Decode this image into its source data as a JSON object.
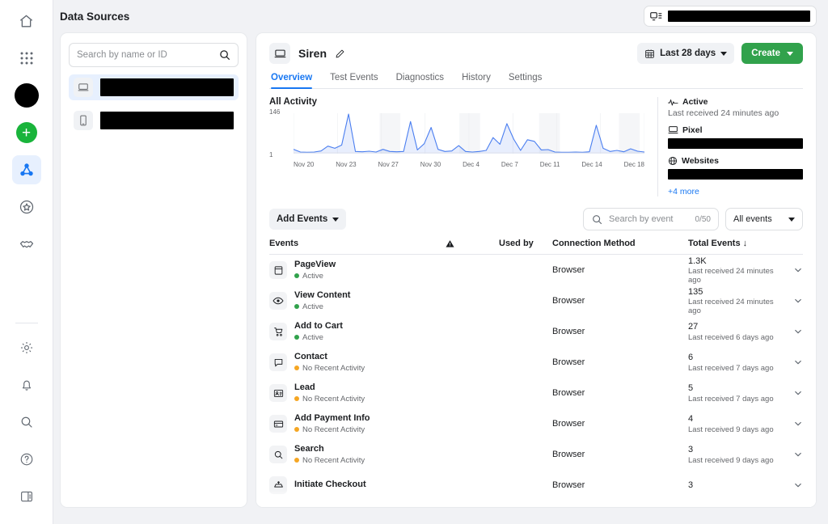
{
  "header": {
    "page_title": "Data Sources",
    "account_pill_icon": "business-account-icon",
    "account_pill_value": "REDACTED"
  },
  "rail": {
    "items": [
      {
        "name": "home-icon",
        "label": "Home"
      },
      {
        "name": "apps-grid-icon",
        "label": "All tools"
      },
      {
        "name": "avatar",
        "label": "Account"
      },
      {
        "name": "plus-circle-icon",
        "label": "Create"
      },
      {
        "name": "data-sources-icon",
        "label": "Data sources",
        "active": true
      },
      {
        "name": "star-badge-icon",
        "label": "Rewards"
      },
      {
        "name": "handshake-icon",
        "label": "Partners"
      }
    ],
    "bottom_items": [
      {
        "name": "gear-icon",
        "label": "Settings"
      },
      {
        "name": "bell-icon",
        "label": "Notifications"
      },
      {
        "name": "search-icon",
        "label": "Search"
      },
      {
        "name": "help-icon",
        "label": "Help"
      },
      {
        "name": "panel-toggle-icon",
        "label": "Toggle panel"
      }
    ]
  },
  "source_list": {
    "search_placeholder": "Search by name or ID",
    "search_value": "",
    "items": [
      {
        "icon": "pixel-icon",
        "label": "REDACTED",
        "selected": true
      },
      {
        "icon": "mobile-app-icon",
        "label": "REDACTED",
        "selected": false
      }
    ]
  },
  "source": {
    "icon": "pixel-icon",
    "name": "Siren",
    "edit_icon": "pencil-icon",
    "date_range": "Last 28 days",
    "create_button": "Create",
    "tabs": [
      {
        "label": "Overview",
        "active": true
      },
      {
        "label": "Test Events",
        "active": false
      },
      {
        "label": "Diagnostics",
        "active": false
      },
      {
        "label": "History",
        "active": false
      },
      {
        "label": "Settings",
        "active": false
      }
    ]
  },
  "activity": {
    "title": "All Activity"
  },
  "info_panel": {
    "status_label": "Active",
    "status_sub": "Last received 24 minutes ago",
    "pixel_label": "Pixel",
    "pixel_value": "REDACTED",
    "websites_label": "Websites",
    "websites_value": "REDACTED",
    "more_link": "+4 more"
  },
  "events_toolbar": {
    "add_events": "Add Events",
    "search_placeholder": "Search by event",
    "search_value": "",
    "search_counter": "0/50",
    "filter_value": "All events"
  },
  "events_table": {
    "columns": {
      "events": "Events",
      "warning_icon": "warning-triangle-icon",
      "used_by": "Used by",
      "connection_method": "Connection Method",
      "total_events": "Total Events",
      "sort_arrow": "↓"
    },
    "rows": [
      {
        "icon": "page-view-icon",
        "name": "PageView",
        "status": "Active",
        "status_color": "#31a24c",
        "used_by": "",
        "connection": "Browser",
        "total": "1.3K",
        "last": "Last received 24 minutes ago"
      },
      {
        "icon": "eye-icon",
        "name": "View Content",
        "status": "Active",
        "status_color": "#31a24c",
        "used_by": "",
        "connection": "Browser",
        "total": "135",
        "last": "Last received 24 minutes ago"
      },
      {
        "icon": "cart-icon",
        "name": "Add to Cart",
        "status": "Active",
        "status_color": "#31a24c",
        "used_by": "",
        "connection": "Browser",
        "total": "27",
        "last": "Last received 6 days ago"
      },
      {
        "icon": "chat-bubble-icon",
        "name": "Contact",
        "status": "No Recent Activity",
        "status_color": "#f5a623",
        "used_by": "",
        "connection": "Browser",
        "total": "6",
        "last": "Last received 7 days ago"
      },
      {
        "icon": "contact-card-icon",
        "name": "Lead",
        "status": "No Recent Activity",
        "status_color": "#f5a623",
        "used_by": "",
        "connection": "Browser",
        "total": "5",
        "last": "Last received 7 days ago"
      },
      {
        "icon": "credit-card-icon",
        "name": "Add Payment Info",
        "status": "No Recent Activity",
        "status_color": "#f5a623",
        "used_by": "",
        "connection": "Browser",
        "total": "4",
        "last": "Last received 9 days ago"
      },
      {
        "icon": "search-icon",
        "name": "Search",
        "status": "No Recent Activity",
        "status_color": "#f5a623",
        "used_by": "",
        "connection": "Browser",
        "total": "3",
        "last": "Last received 9 days ago"
      },
      {
        "icon": "initiate-checkout-icon",
        "name": "Initiate Checkout",
        "status": "",
        "status_color": "#f5a623",
        "used_by": "",
        "connection": "Browser",
        "total": "3",
        "last": ""
      }
    ]
  },
  "chart_data": {
    "type": "area",
    "title": "All Activity",
    "xlabel": "",
    "ylabel": "",
    "ylim": [
      1,
      146
    ],
    "ytick_labels": [
      "146",
      "1"
    ],
    "grid": true,
    "legend": "none",
    "x_tick_labels": [
      "Nov 20",
      "Nov 23",
      "Nov 27",
      "Nov 30",
      "Dec 4",
      "Dec 7",
      "Dec 11",
      "Dec 14",
      "Dec 18"
    ],
    "x": [
      "Nov 20",
      "Nov 21",
      "Nov 22",
      "Nov 23",
      "Nov 24",
      "Nov 25",
      "Nov 26",
      "Nov 27",
      "Nov 28",
      "Nov 29",
      "Nov 30",
      "Dec 1",
      "Dec 2",
      "Dec 3",
      "Dec 4",
      "Dec 5",
      "Dec 6",
      "Dec 7",
      "Dec 8",
      "Dec 9",
      "Dec 10",
      "Dec 11",
      "Dec 12",
      "Dec 13",
      "Dec 14",
      "Dec 15",
      "Dec 16",
      "Dec 17",
      "Dec 18"
    ],
    "series": [
      {
        "name": "All Activity",
        "color": "#4a7ef0",
        "values": [
          14,
          4,
          3,
          4,
          8,
          26,
          18,
          30,
          146,
          6,
          5,
          7,
          4,
          14,
          6,
          5,
          6,
          118,
          12,
          35,
          96,
          14,
          6,
          8,
          28,
          6,
          4,
          6,
          10,
          58,
          33,
          110,
          52,
          10,
          50,
          44,
          12,
          13,
          4,
          3,
          3,
          4,
          3,
          5,
          104,
          18,
          6,
          10,
          5,
          16,
          7,
          4
        ]
      }
    ]
  }
}
